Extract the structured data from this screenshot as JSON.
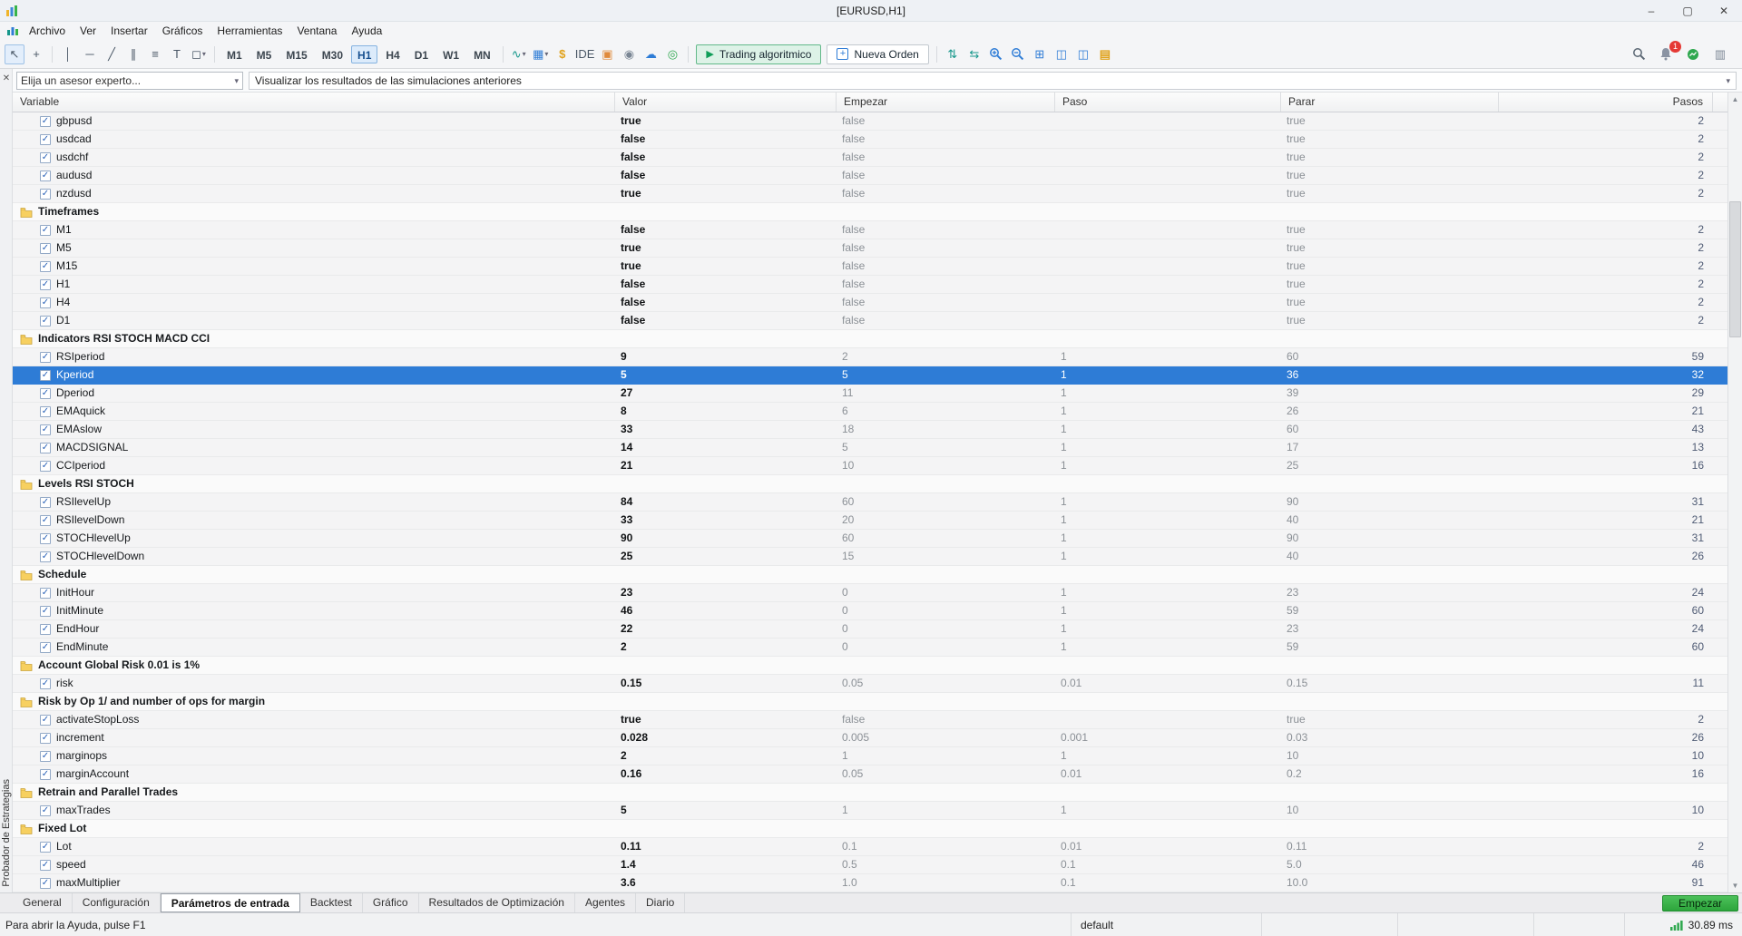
{
  "titlebar": {
    "title": "[EURUSD,H1]",
    "minimize": "–",
    "maximize": "▢",
    "close": "✕"
  },
  "menu": {
    "items": [
      "Archivo",
      "Ver",
      "Insertar",
      "Gráficos",
      "Herramientas",
      "Ventana",
      "Ayuda"
    ]
  },
  "toolbar": {
    "timeframes": [
      "M1",
      "M5",
      "M15",
      "M30",
      "H1",
      "H4",
      "D1",
      "W1",
      "MN"
    ],
    "active_timeframe": "H1",
    "ide_label": "IDE",
    "algo_trading_label": "Trading algoritmico",
    "new_order_label": "Nueva Orden",
    "notification_count": "1"
  },
  "tester_bar": {
    "expert_placeholder": "Elija un asesor experto...",
    "results_label": "Visualizar los resultados de las simulaciones anteriores"
  },
  "sidebar_label": "Probador de Estrategias",
  "table": {
    "columns": [
      "Variable",
      "Valor",
      "Empezar",
      "Paso",
      "Parar",
      "Pasos"
    ],
    "rows": [
      {
        "type": "param",
        "name": "gbpusd",
        "valor": "true",
        "empezar": "false",
        "paso": "",
        "parar": "true",
        "pasos": "2",
        "checked": true
      },
      {
        "type": "param",
        "name": "usdcad",
        "valor": "false",
        "empezar": "false",
        "paso": "",
        "parar": "true",
        "pasos": "2",
        "checked": true
      },
      {
        "type": "param",
        "name": "usdchf",
        "valor": "false",
        "empezar": "false",
        "paso": "",
        "parar": "true",
        "pasos": "2",
        "checked": true
      },
      {
        "type": "param",
        "name": "audusd",
        "valor": "false",
        "empezar": "false",
        "paso": "",
        "parar": "true",
        "pasos": "2",
        "checked": true
      },
      {
        "type": "param",
        "name": "nzdusd",
        "valor": "true",
        "empezar": "false",
        "paso": "",
        "parar": "true",
        "pasos": "2",
        "checked": true
      },
      {
        "type": "group",
        "name": "Timeframes"
      },
      {
        "type": "param",
        "name": "M1",
        "valor": "false",
        "empezar": "false",
        "paso": "",
        "parar": "true",
        "pasos": "2",
        "checked": true
      },
      {
        "type": "param",
        "name": "M5",
        "valor": "true",
        "empezar": "false",
        "paso": "",
        "parar": "true",
        "pasos": "2",
        "checked": true
      },
      {
        "type": "param",
        "name": "M15",
        "valor": "true",
        "empezar": "false",
        "paso": "",
        "parar": "true",
        "pasos": "2",
        "checked": true
      },
      {
        "type": "param",
        "name": "H1",
        "valor": "false",
        "empezar": "false",
        "paso": "",
        "parar": "true",
        "pasos": "2",
        "checked": true
      },
      {
        "type": "param",
        "name": "H4",
        "valor": "false",
        "empezar": "false",
        "paso": "",
        "parar": "true",
        "pasos": "2",
        "checked": true
      },
      {
        "type": "param",
        "name": "D1",
        "valor": "false",
        "empezar": "false",
        "paso": "",
        "parar": "true",
        "pasos": "2",
        "checked": true
      },
      {
        "type": "group",
        "name": "Indicators RSI STOCH MACD CCI"
      },
      {
        "type": "param",
        "name": "RSIperiod",
        "valor": "9",
        "empezar": "2",
        "paso": "1",
        "parar": "60",
        "pasos": "59",
        "checked": true
      },
      {
        "type": "param",
        "name": "Kperiod",
        "valor": "5",
        "empezar": "5",
        "paso": "1",
        "parar": "36",
        "pasos": "32",
        "checked": true,
        "selected": true
      },
      {
        "type": "param",
        "name": "Dperiod",
        "valor": "27",
        "empezar": "11",
        "paso": "1",
        "parar": "39",
        "pasos": "29",
        "checked": true
      },
      {
        "type": "param",
        "name": "EMAquick",
        "valor": "8",
        "empezar": "6",
        "paso": "1",
        "parar": "26",
        "pasos": "21",
        "checked": true
      },
      {
        "type": "param",
        "name": "EMAslow",
        "valor": "33",
        "empezar": "18",
        "paso": "1",
        "parar": "60",
        "pasos": "43",
        "checked": true
      },
      {
        "type": "param",
        "name": "MACDSIGNAL",
        "valor": "14",
        "empezar": "5",
        "paso": "1",
        "parar": "17",
        "pasos": "13",
        "checked": true
      },
      {
        "type": "param",
        "name": "CCIperiod",
        "valor": "21",
        "empezar": "10",
        "paso": "1",
        "parar": "25",
        "pasos": "16",
        "checked": true
      },
      {
        "type": "group",
        "name": "Levels RSI STOCH"
      },
      {
        "type": "param",
        "name": "RSIlevelUp",
        "valor": "84",
        "empezar": "60",
        "paso": "1",
        "parar": "90",
        "pasos": "31",
        "checked": true
      },
      {
        "type": "param",
        "name": "RSIlevelDown",
        "valor": "33",
        "empezar": "20",
        "paso": "1",
        "parar": "40",
        "pasos": "21",
        "checked": true
      },
      {
        "type": "param",
        "name": "STOCHlevelUp",
        "valor": "90",
        "empezar": "60",
        "paso": "1",
        "parar": "90",
        "pasos": "31",
        "checked": true
      },
      {
        "type": "param",
        "name": "STOCHlevelDown",
        "valor": "25",
        "empezar": "15",
        "paso": "1",
        "parar": "40",
        "pasos": "26",
        "checked": true
      },
      {
        "type": "group",
        "name": "Schedule"
      },
      {
        "type": "param",
        "name": "InitHour",
        "valor": "23",
        "empezar": "0",
        "paso": "1",
        "parar": "23",
        "pasos": "24",
        "checked": true
      },
      {
        "type": "param",
        "name": "InitMinute",
        "valor": "46",
        "empezar": "0",
        "paso": "1",
        "parar": "59",
        "pasos": "60",
        "checked": true
      },
      {
        "type": "param",
        "name": "EndHour",
        "valor": "22",
        "empezar": "0",
        "paso": "1",
        "parar": "23",
        "pasos": "24",
        "checked": true
      },
      {
        "type": "param",
        "name": "EndMinute",
        "valor": "2",
        "empezar": "0",
        "paso": "1",
        "parar": "59",
        "pasos": "60",
        "checked": true
      },
      {
        "type": "group",
        "name": "Account Global Risk 0.01 is 1%"
      },
      {
        "type": "param",
        "name": "risk",
        "valor": "0.15",
        "empezar": "0.05",
        "paso": "0.01",
        "parar": "0.15",
        "pasos": "11",
        "checked": true
      },
      {
        "type": "group",
        "name": "Risk by Op 1/ and number of ops for margin"
      },
      {
        "type": "param",
        "name": "activateStopLoss",
        "valor": "true",
        "empezar": "false",
        "paso": "",
        "parar": "true",
        "pasos": "2",
        "checked": true
      },
      {
        "type": "param",
        "name": "increment",
        "valor": "0.028",
        "empezar": "0.005",
        "paso": "0.001",
        "parar": "0.03",
        "pasos": "26",
        "checked": true
      },
      {
        "type": "param",
        "name": "marginops",
        "valor": "2",
        "empezar": "1",
        "paso": "1",
        "parar": "10",
        "pasos": "10",
        "checked": true
      },
      {
        "type": "param",
        "name": "marginAccount",
        "valor": "0.16",
        "empezar": "0.05",
        "paso": "0.01",
        "parar": "0.2",
        "pasos": "16",
        "checked": true
      },
      {
        "type": "group",
        "name": "Retrain and Parallel Trades"
      },
      {
        "type": "param",
        "name": "maxTrades",
        "valor": "5",
        "empezar": "1",
        "paso": "1",
        "parar": "10",
        "pasos": "10",
        "checked": true
      },
      {
        "type": "group",
        "name": "Fixed Lot"
      },
      {
        "type": "param",
        "name": "Lot",
        "valor": "0.11",
        "empezar": "0.1",
        "paso": "0.01",
        "parar": "0.11",
        "pasos": "2",
        "checked": true
      },
      {
        "type": "param",
        "name": "speed",
        "valor": "1.4",
        "empezar": "0.5",
        "paso": "0.1",
        "parar": "5.0",
        "pasos": "46",
        "checked": true
      },
      {
        "type": "param",
        "name": "maxMultiplier",
        "valor": "3.6",
        "empezar": "1.0",
        "paso": "0.1",
        "parar": "10.0",
        "pasos": "91",
        "checked": true
      }
    ]
  },
  "tabs": {
    "items": [
      "General",
      "Configuración",
      "Parámetros de entrada",
      "Backtest",
      "Gráfico",
      "Resultados de Optimización",
      "Agentes",
      "Diario"
    ],
    "active": "Parámetros de entrada",
    "start_button": "Empezar"
  },
  "statusbar": {
    "help_text": "Para abrir la Ayuda, pulse F1",
    "profile": "default",
    "latency": "30.89 ms"
  }
}
